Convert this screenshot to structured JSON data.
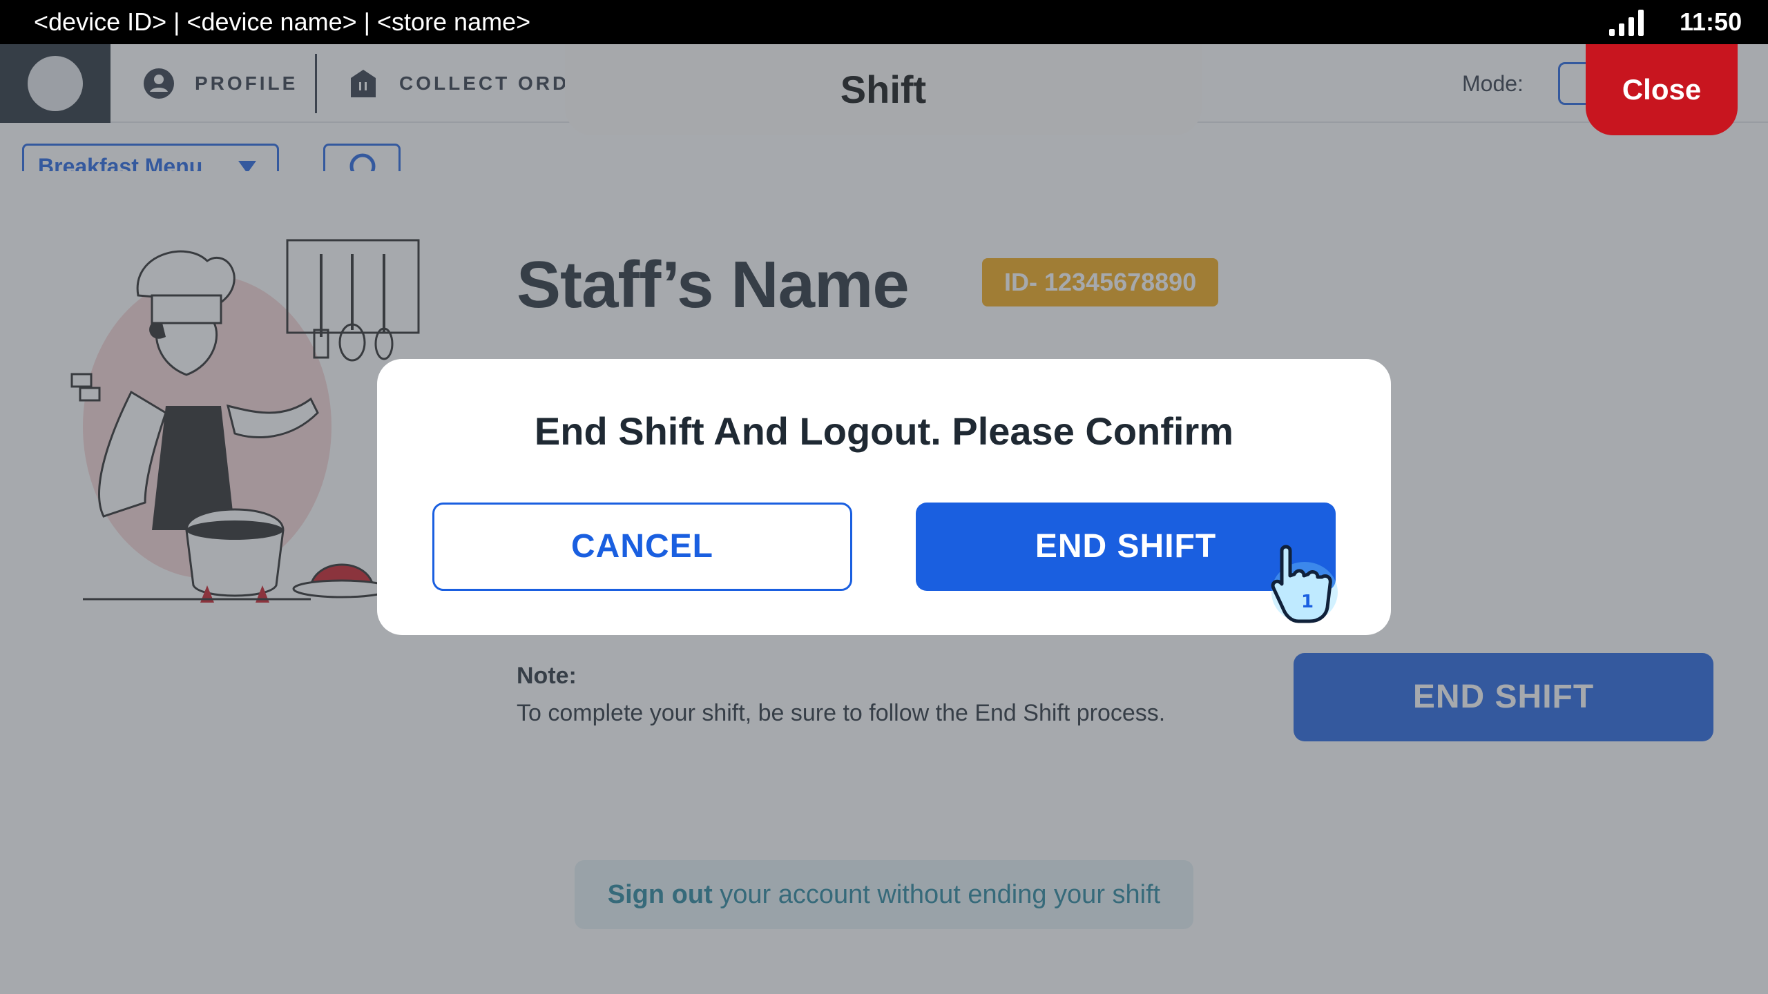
{
  "status_bar": {
    "device_info": "<device ID> | <device name> | <store name>",
    "time": "11:50",
    "signal_icon": "signal-bars-icon"
  },
  "app_bar": {
    "nav": [
      {
        "label": "PROFILE",
        "icon": "user-icon"
      },
      {
        "label": "COLLECT ORDE",
        "icon": "store-bag-icon"
      }
    ],
    "mode_label": "Mode:"
  },
  "sub_bar": {
    "menu_dropdown": "Breakfast Menu"
  },
  "shift_sheet": {
    "tab_title": "Shift",
    "close_label": "Close",
    "staff_name": "Staff’s Name",
    "staff_id": "ID- 12345678890",
    "note_label": "Note:",
    "note_text": "To complete your shift, be sure to follow the End Shift process.",
    "end_shift_label": "END SHIFT",
    "signout_bold": "Sign out",
    "signout_rest": " your account without ending your shift"
  },
  "dialog": {
    "title": "End Shift And Logout. Please Confirm",
    "cancel_label": "CANCEL",
    "confirm_label": "END SHIFT"
  },
  "colors": {
    "primary": "#1a5fe0",
    "danger": "#c8151f",
    "badge": "#f3a60f",
    "overlay": "#4e545c"
  }
}
